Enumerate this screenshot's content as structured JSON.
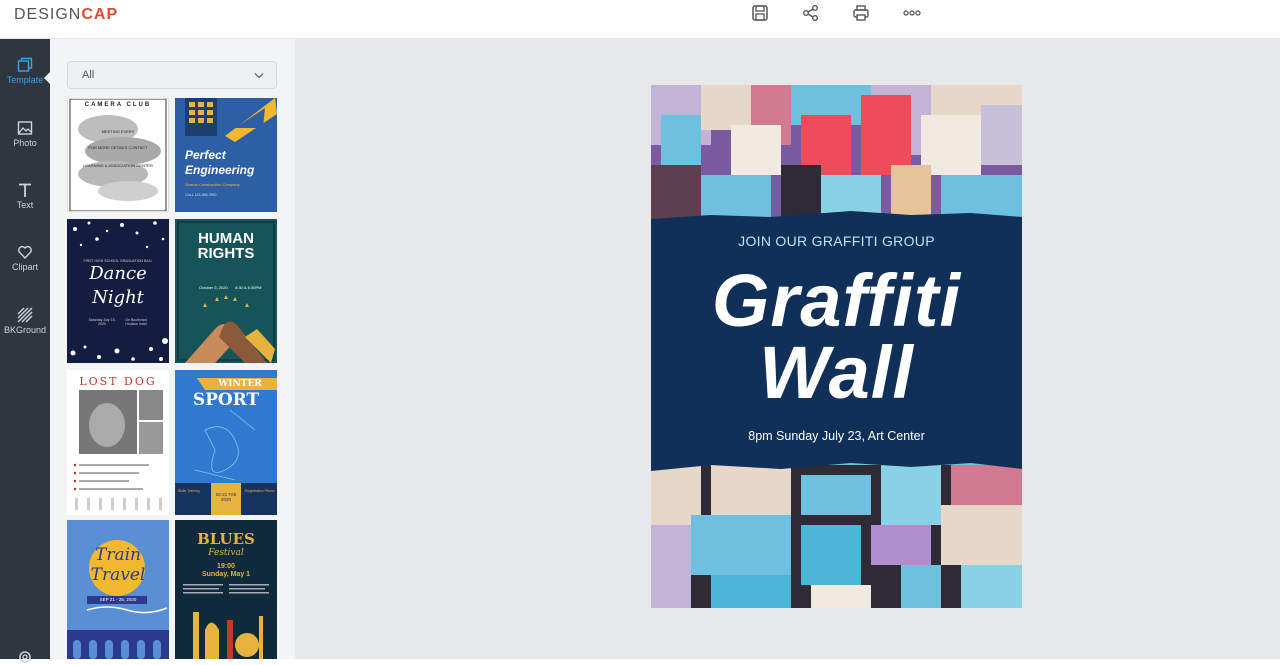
{
  "app": {
    "logo_part1": "DESIGN",
    "logo_part2": "CAP"
  },
  "toolbar": {
    "icons": [
      "save-icon",
      "share-icon",
      "print-icon",
      "more-icon"
    ]
  },
  "sidebar": {
    "items": [
      {
        "label": "Template",
        "icon": "template-icon"
      },
      {
        "label": "Photo",
        "icon": "photo-icon"
      },
      {
        "label": "Text",
        "icon": "text-icon"
      },
      {
        "label": "Clipart",
        "icon": "clipart-icon"
      },
      {
        "label": "BKGround",
        "icon": "background-icon"
      }
    ],
    "bottom_icon": "settings-icon"
  },
  "panel": {
    "filter_value": "All",
    "templates": {
      "camera_club": {
        "title": "CAMERA CLUB",
        "sub": "MEETING EVERY",
        "line2": "FOR MORE DETAILS CONTACT",
        "line3": "LEARNING & ASSOCIATION CENTER"
      },
      "engineering": {
        "title1": "Perfect",
        "title2": "Engineering",
        "sub": "Sharon Construction Company",
        "line": "CALL 123-456-7890"
      },
      "dance": {
        "top": "FIRST HIGH SCHOOL GRADUATION BALL",
        "title1": "Dance",
        "title2": "Night",
        "date": "Saturday July 15, 2020",
        "place": "On Boulevard Houston hotel"
      },
      "human": {
        "title1": "HUMAN",
        "title2": "RIGHTS",
        "date": "October 5, 2020",
        "time": "4:30 & 6:30PM"
      },
      "lostdog": {
        "title": "LOST DOG"
      },
      "winter": {
        "title1": "WINTER",
        "title2": "SPORT",
        "c1": "Skills Training",
        "c2": "02-21 Feb 2020",
        "c3": "Registration Phone"
      },
      "train": {
        "title1": "Train",
        "title2": "Travel",
        "date": "SEP 21 - 25, 2020"
      },
      "blues": {
        "title1": "BLUES",
        "title2": "Festival",
        "time": "19:00",
        "date": "Sunday, May 1"
      }
    }
  },
  "poster": {
    "subtitle": "JOIN OUR GRAFFITI GROUP",
    "title1": "Graffiti",
    "title2": "Wall",
    "details": "8pm Sunday July 23, Art Center",
    "colors": {
      "band": "#10305a",
      "text": "#ffffff",
      "subtitle": "#bfe3f0"
    }
  }
}
